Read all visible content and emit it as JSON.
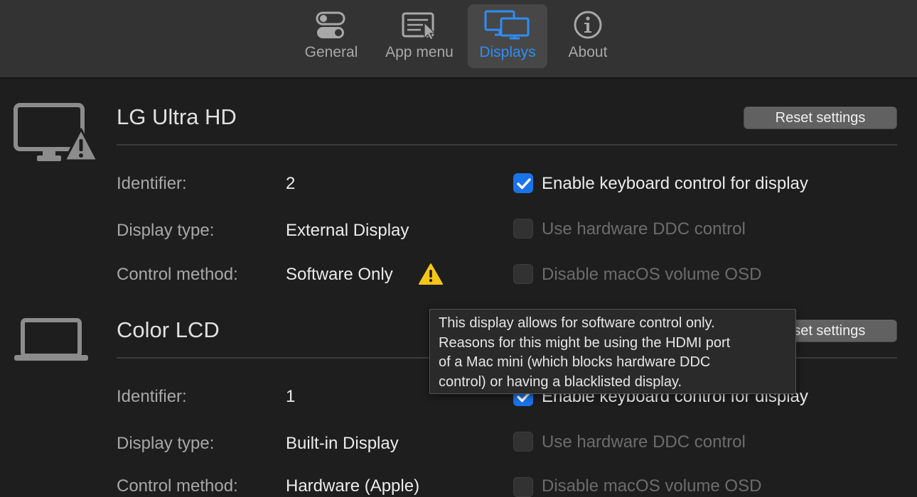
{
  "toolbar": {
    "tabs": [
      {
        "label": "General",
        "icon": "toggles-icon",
        "active": false
      },
      {
        "label": "App menu",
        "icon": "app-menu-icon",
        "active": false
      },
      {
        "label": "Displays",
        "icon": "displays-icon",
        "active": true
      },
      {
        "label": "About",
        "icon": "info-icon",
        "active": false
      }
    ]
  },
  "displays": [
    {
      "name": "LG Ultra HD",
      "icon": "external-monitor-warning-icon",
      "reset_label": "Reset settings",
      "identifier_label": "Identifier:",
      "identifier": "2",
      "type_label": "Display type:",
      "type": "External Display",
      "method_label": "Control method:",
      "method": "Software Only",
      "method_warning_icon": "warning-icon",
      "options": [
        {
          "label": "Enable keyboard control for display",
          "checked": true,
          "enabled": true
        },
        {
          "label": "Use hardware DDC control",
          "checked": false,
          "enabled": false
        },
        {
          "label": "Disable macOS volume OSD",
          "checked": false,
          "enabled": false
        }
      ]
    },
    {
      "name": "Color LCD",
      "icon": "laptop-icon",
      "reset_label": "Reset settings",
      "identifier_label": "Identifier:",
      "identifier": "1",
      "type_label": "Display type:",
      "type": "Built-in Display",
      "method_label": "Control method:",
      "method": "Hardware (Apple)",
      "options": [
        {
          "label": "Enable keyboard control for display",
          "checked": true,
          "enabled": true
        },
        {
          "label": "Use hardware DDC control",
          "checked": false,
          "enabled": false
        },
        {
          "label": "Disable macOS volume OSD",
          "checked": false,
          "enabled": false
        }
      ]
    }
  ],
  "tooltip": {
    "lines": [
      "This display allows for software control only.",
      "Reasons for this might be using the HDMI port",
      "of a Mac mini (which blocks hardware DDC",
      "control) or having a blacklisted display."
    ]
  },
  "colors": {
    "accent": "#2f8df5",
    "checkbox_checked": "#1a73e8",
    "warning": "#f5c518"
  }
}
